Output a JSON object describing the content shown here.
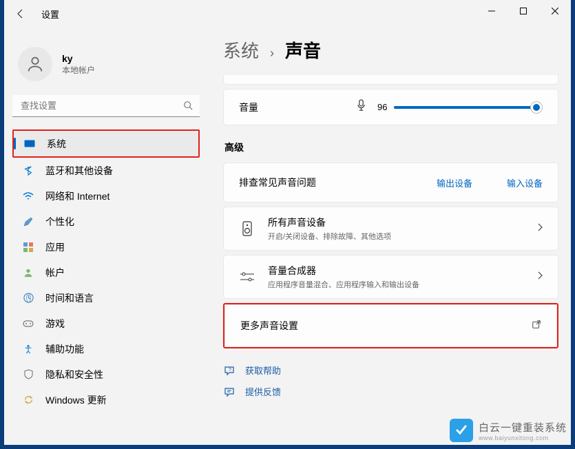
{
  "app": {
    "title": "设置"
  },
  "user": {
    "name": "ky",
    "subtitle": "本地帐户"
  },
  "search": {
    "placeholder": "查找设置"
  },
  "nav": {
    "items": [
      {
        "label": "系统"
      },
      {
        "label": "蓝牙和其他设备"
      },
      {
        "label": "网络和 Internet"
      },
      {
        "label": "个性化"
      },
      {
        "label": "应用"
      },
      {
        "label": "帐户"
      },
      {
        "label": "时间和语言"
      },
      {
        "label": "游戏"
      },
      {
        "label": "辅助功能"
      },
      {
        "label": "隐私和安全性"
      },
      {
        "label": "Windows 更新"
      }
    ]
  },
  "breadcrumb": {
    "parent": "系统",
    "current": "声音"
  },
  "volume": {
    "label": "音量",
    "value": "96"
  },
  "advanced": {
    "heading": "高级",
    "troubleshoot": {
      "title": "排查常见声音问题",
      "output": "输出设备",
      "input": "输入设备"
    },
    "allDevices": {
      "title": "所有声音设备",
      "desc": "开启/关闭设备、排除故障、其他选项"
    },
    "mixer": {
      "title": "音量合成器",
      "desc": "应用程序音量混合、应用程序输入和输出设备"
    },
    "more": {
      "title": "更多声音设置"
    }
  },
  "footer": {
    "help": "获取帮助",
    "feedback": "提供反馈"
  },
  "watermark": {
    "line1": "白云一键重装系统",
    "line2": "www.baiyunxitong.com"
  }
}
